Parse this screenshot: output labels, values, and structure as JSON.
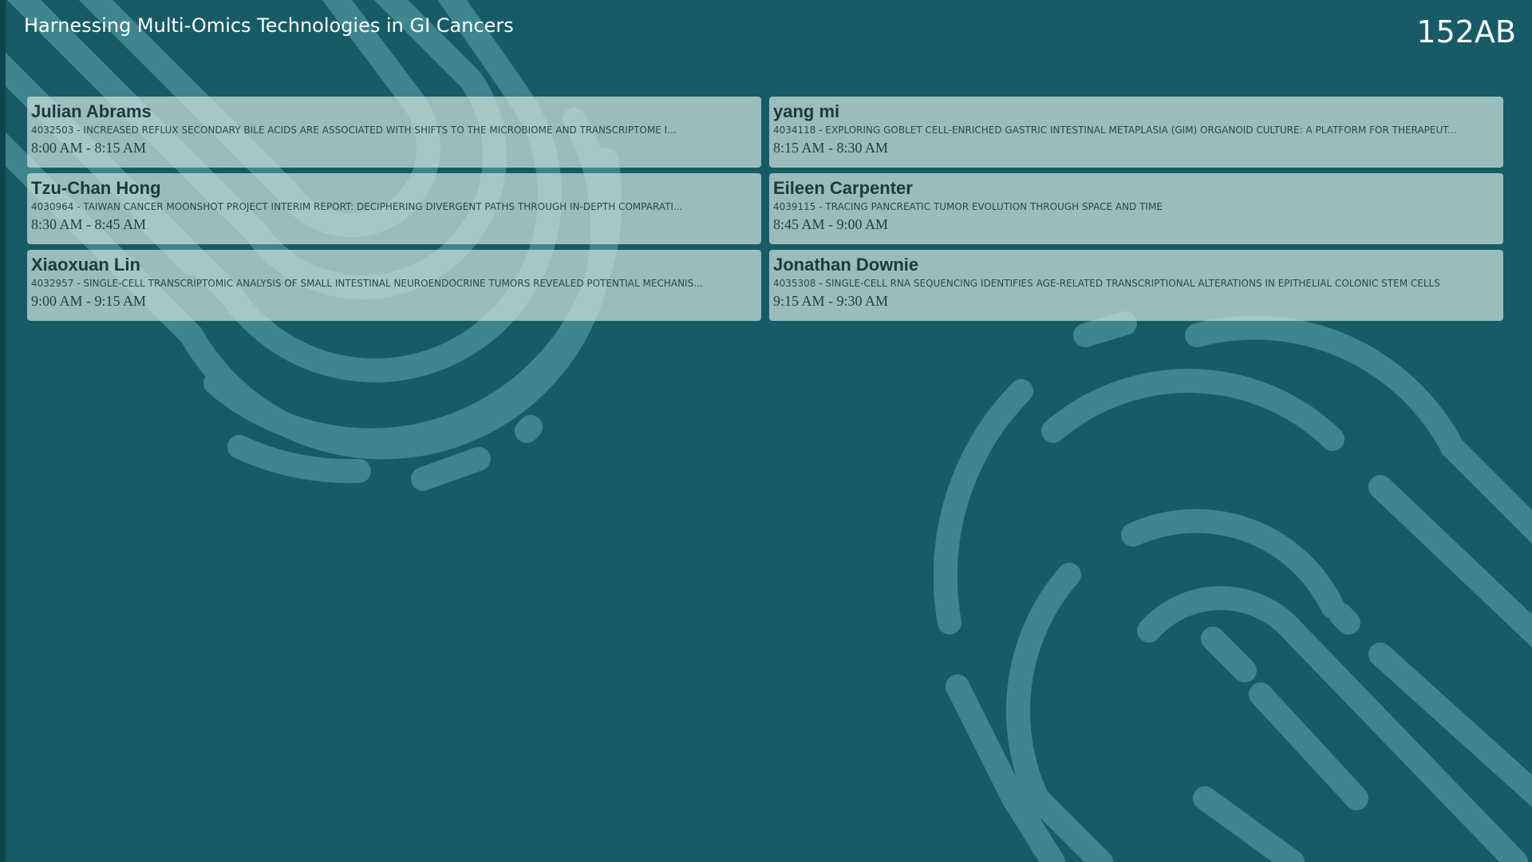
{
  "header": {
    "session_title": "Harnessing Multi-Omics Technologies in GI Cancers",
    "room": "152AB"
  },
  "colors": {
    "background": "#175b66",
    "card": "#cde2de",
    "ridges": "#5fa8ad"
  },
  "presentations": [
    {
      "speaker": "Julian Abrams",
      "abstract": "4032503 - INCREASED REFLUX SECONDARY BILE ACIDS ARE ASSOCIATED WITH SHIFTS TO THE MICROBIOME AND TRANSCRIPTOME I...",
      "time": "8:00 AM - 8:15 AM"
    },
    {
      "speaker": "yang mi",
      "abstract": "4034118 - EXPLORING GOBLET CELL-ENRICHED GASTRIC INTESTINAL METAPLASIA (GIM) ORGANOID CULTURE: A PLATFORM FOR THERAPEUT...",
      "time": "8:15 AM - 8:30 AM"
    },
    {
      "speaker": "Tzu-Chan Hong",
      "abstract": "4030964 - TAIWAN CANCER MOONSHOT PROJECT INTERIM REPORT: DECIPHERING DIVERGENT PATHS THROUGH IN-DEPTH COMPARATI...",
      "time": "8:30 AM - 8:45 AM"
    },
    {
      "speaker": "Eileen Carpenter",
      "abstract": "4039115 - TRACING PANCREATIC TUMOR EVOLUTION THROUGH SPACE AND TIME",
      "time": "8:45 AM - 9:00 AM"
    },
    {
      "speaker": "Xiaoxuan Lin",
      "abstract": "4032957 - SINGLE-CELL TRANSCRIPTOMIC ANALYSIS OF SMALL INTESTINAL NEUROENDOCRINE TUMORS REVEALED POTENTIAL MECHANIS...",
      "time": "9:00 AM - 9:15 AM"
    },
    {
      "speaker": "Jonathan Downie",
      "abstract": "4035308 - SINGLE-CELL RNA SEQUENCING IDENTIFIES AGE-RELATED TRANSCRIPTIONAL ALTERATIONS IN EPITHELIAL COLONIC STEM CELLS",
      "time": "9:15 AM - 9:30 AM"
    }
  ]
}
